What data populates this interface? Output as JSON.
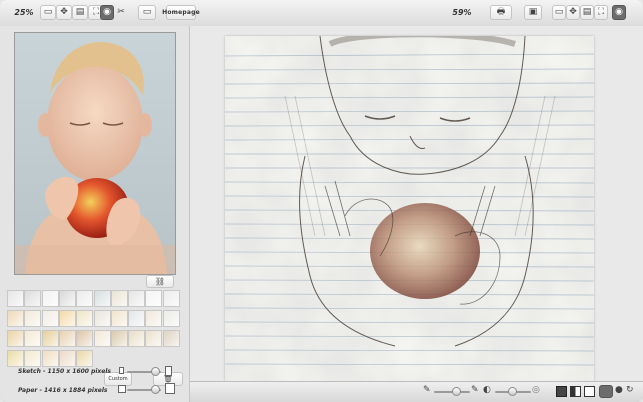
{
  "toolbar_left": {
    "zoom": "25%",
    "homepage_label": "Homepage",
    "icons": [
      "fit-icon",
      "zoom-in-icon",
      "actual-size-icon",
      "fullscreen-icon",
      "camera-icon",
      "scissors-icon",
      "open-folder-icon"
    ]
  },
  "toolbar_right": {
    "zoom": "59%",
    "icons": [
      "print-icon",
      "save-icon",
      "zoom-in-icon",
      "fit-icon",
      "fullscreen-icon",
      "camera-icon"
    ]
  },
  "left_panel": {
    "custom_label": "Custom",
    "sketch_info": "Sketch - 1150 x 1600 pixels",
    "paper_info": "Paper - 1416 x 1884 pixels"
  },
  "paper_textures": [
    "#e6e6e6",
    "#dcdcdc",
    "#f2f2f2",
    "#d9d9d9",
    "#ebebeb",
    "#d6dee0",
    "#e9e3d4",
    "#e5e5e5",
    "#f4f4f4",
    "#ececec",
    "#ecd9b8",
    "#f0ead8",
    "#f1ece4",
    "#f3d9a6",
    "#efe5c6",
    "#e9e4dc",
    "#f0e3cc",
    "#e3e6e9",
    "#f0e8dc",
    "#ecece8",
    "#e9d4a4",
    "#f3ead4",
    "#e6cf98",
    "#e8d1b0",
    "#dec5a5",
    "#f1e8d6",
    "#d9c9ab",
    "#e8dcc6",
    "#ebe2ce",
    "#ddd4c2",
    "#eadca6",
    "#f1e9cf",
    "#efddc2",
    "#ecd9c6",
    "#e9d8a8"
  ],
  "colors": {
    "accent_dark": "#6d6d6d",
    "panel_bg": "#e4e4e4"
  }
}
